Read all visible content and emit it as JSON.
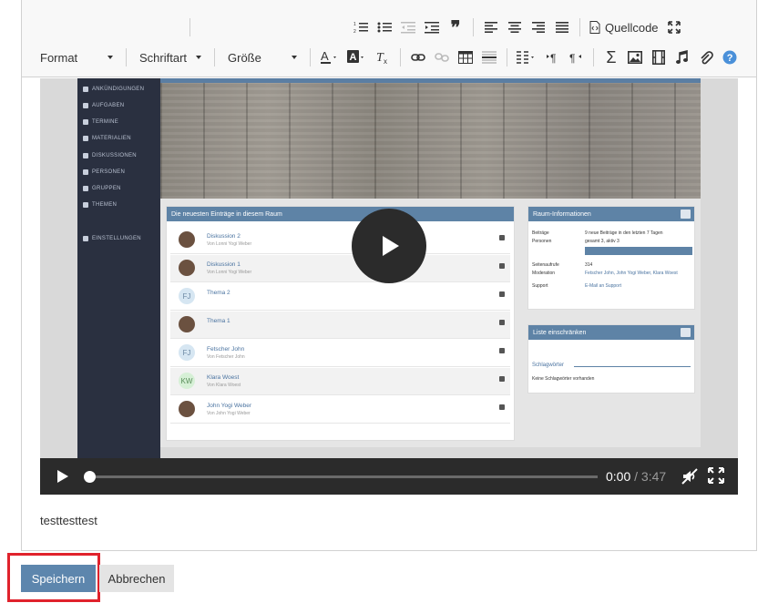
{
  "toolbar": {
    "row1": {
      "icons": [
        "numbered-list-icon",
        "bulleted-list-icon",
        "outdent-icon",
        "indent-icon",
        "blockquote-icon",
        "align-left-icon",
        "align-center-icon",
        "align-right-icon",
        "align-justify-icon",
        "source-icon",
        "maximize-icon"
      ],
      "source_label": "Quellcode"
    },
    "row2": {
      "format_label": "Format",
      "font_label": "Schriftart",
      "size_label": "Größe",
      "icons": [
        "text-color-icon",
        "background-color-icon",
        "remove-format-icon",
        "link-icon",
        "unlink-icon",
        "table-icon",
        "horizontal-rule-icon",
        "layout-icon",
        "ltr-icon",
        "rtl-icon",
        "math-icon",
        "image-icon",
        "video-icon",
        "audio-icon",
        "attachment-icon",
        "help-icon"
      ]
    }
  },
  "video": {
    "sidebar_items": [
      "ANKÜNDIGUNGEN",
      "AUFGABEN",
      "TERMINE",
      "MATERIALIEN",
      "DISKUSSIONEN",
      "PERSONEN",
      "GRUPPEN",
      "THEMEN",
      "EINSTELLUNGEN"
    ],
    "feed_title": "Die neuesten Einträge in diesem Raum",
    "entries": [
      {
        "title": "Diskussion 2",
        "meta": "Von Lonni Yogi Weber",
        "type": "avatar"
      },
      {
        "title": "Diskussion 1",
        "meta": "Von Lonni Yogi Weber",
        "type": "avatar"
      },
      {
        "title": "Thema 2",
        "meta": "",
        "type": "FJ"
      },
      {
        "title": "Thema 1",
        "meta": "",
        "type": "avatar"
      },
      {
        "title": "Fetscher John",
        "meta": "Von Fetscher John",
        "type": "FJ"
      },
      {
        "title": "Klara Woest",
        "meta": "Von Klara Woest",
        "type": "KW"
      },
      {
        "title": "John Yogi Weber",
        "meta": "Von John Yogi Weber",
        "type": "avatar"
      }
    ],
    "info_title": "Raum-Informationen",
    "info_rows": [
      {
        "k": "Beiträge",
        "v": "9 neue Beiträge in den letzten 7 Tagen"
      },
      {
        "k": "Personen",
        "v": "gesamt 3, aktiv 3"
      },
      {
        "k": "Seitenaufrufe",
        "v": "314"
      },
      {
        "k": "Moderation",
        "v": "Fetscher John, John Yogi Weber, Klara Woest"
      },
      {
        "k": "Support",
        "v": "E-Mail an Support"
      }
    ],
    "filter_title": "Liste einschränken",
    "filter_label": "Schlagwörter",
    "filter_empty": "Keine Schlagwörter vorhanden",
    "time_current": "0:00",
    "time_total": "3:47",
    "progress": 0
  },
  "body_text": "testtesttest",
  "actions": {
    "save_label": "Speichern",
    "cancel_label": "Abbrechen"
  }
}
